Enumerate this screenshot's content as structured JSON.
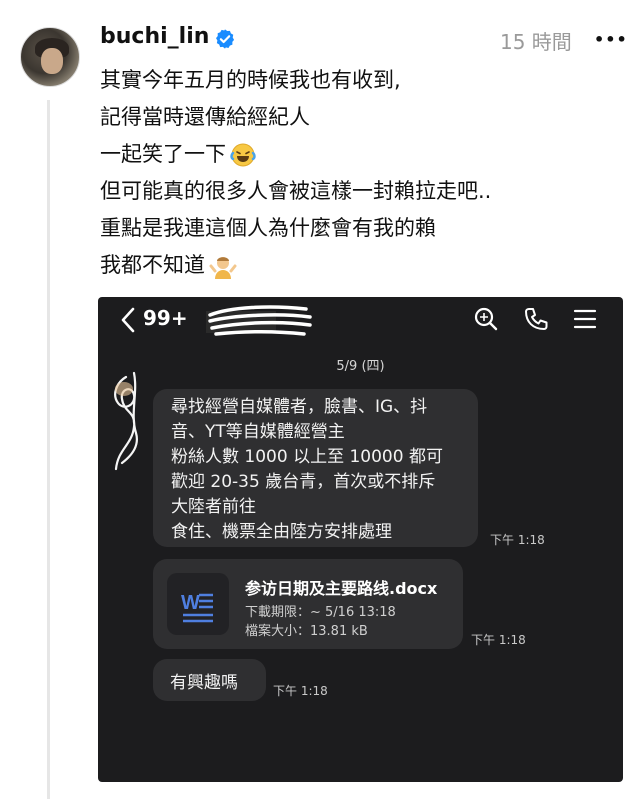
{
  "post": {
    "username": "buchi_lin",
    "time": "15 時間",
    "more_label": "•••",
    "lines": [
      "其實今年五月的時候我也有收到,",
      "記得當時還傳給經紀人",
      "一起笑了一下",
      "但可能真的很多人會被這樣一封賴拉走吧..",
      "重點是我連這個人為什麼會有我的賴",
      "我都不知道"
    ]
  },
  "screenshot": {
    "unread_badge": "99+",
    "date": "5/9 (四)",
    "message1": {
      "lines": [
        "尋找經營自媒體者，臉書、IG、抖",
        "音、YT等自媒體經營主",
        "粉絲人數 1000 以上至 10000 都可",
        "歡迎 20-35 歲台青，首次或不排斥",
        "大陸者前往",
        "食住、機票全由陸方安排處理"
      ],
      "time": "下午 1:18"
    },
    "file": {
      "name": "参访日期及主要路线.docx",
      "deadline": "下載期限：~ 5/16 13:18",
      "size": "檔案大小：13.81 kB",
      "time": "下午 1:18"
    },
    "message3": {
      "text": "有興趣嗎",
      "time": "下午 1:18"
    }
  }
}
